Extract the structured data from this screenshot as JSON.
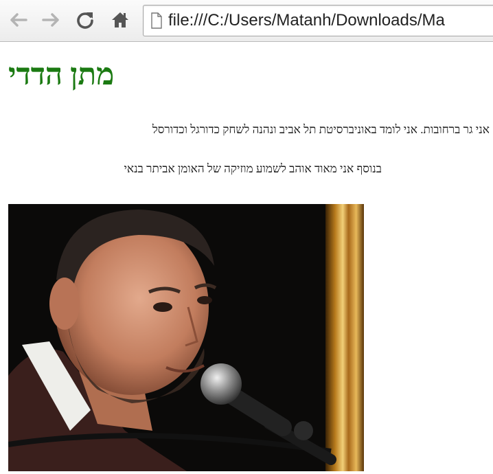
{
  "browser": {
    "url": "file:///C:/Users/Matanh/Downloads/Ma",
    "icons": [
      "back-arrow-icon",
      "forward-arrow-icon",
      "reload-icon",
      "home-icon",
      "page-icon"
    ]
  },
  "page": {
    "title": "מתן הדדי",
    "paragraph1": "אני גר ברחובות. אני לומד באוניברסיטת תל אביב ונהנה לשחק כדורגל וכדורסל",
    "paragraph2": "בנוסף אני מאוד אוהב לשמוע מוזיקה של האומן אביתר בנאי",
    "title_color": "#1b7a12"
  }
}
